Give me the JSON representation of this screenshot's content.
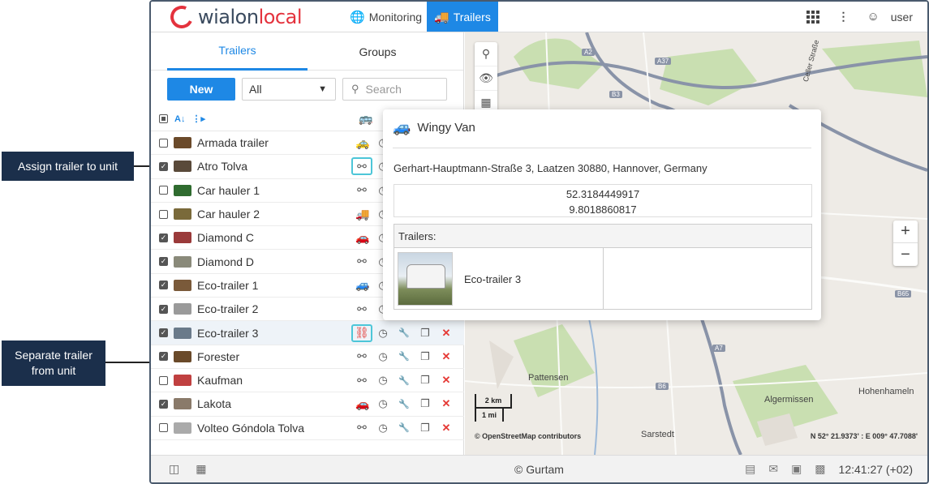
{
  "topbar": {
    "logo_text_a": "wialon",
    "logo_text_b": "local",
    "nav": [
      {
        "label": "Monitoring",
        "icon": "globe-icon"
      },
      {
        "label": "Trailers",
        "icon": "trailer-icon"
      }
    ],
    "user": "user"
  },
  "left_panel": {
    "tabs": [
      "Trailers",
      "Groups"
    ],
    "new_button": "New",
    "filter_value": "All",
    "search_placeholder": "Search",
    "rows": [
      {
        "name": "Armada trailer",
        "checked": false,
        "thumb": "#6b4a2a",
        "veh": "🚕",
        "full": false
      },
      {
        "name": "Atro Tolva",
        "checked": true,
        "thumb": "#5a4a3a",
        "veh": "",
        "full": false
      },
      {
        "name": "Car hauler 1",
        "checked": false,
        "thumb": "#2f6b2f",
        "veh": "",
        "full": false
      },
      {
        "name": "Car hauler 2",
        "checked": false,
        "thumb": "#7a6a3a",
        "veh": "🚚",
        "full": false
      },
      {
        "name": "Diamond C",
        "checked": true,
        "thumb": "#9a3a3a",
        "veh": "🚗",
        "full": false
      },
      {
        "name": "Diamond D",
        "checked": true,
        "thumb": "#8a8a7a",
        "veh": "",
        "full": false
      },
      {
        "name": "Eco-trailer 1",
        "checked": true,
        "thumb": "#7a5a3a",
        "veh": "🚙",
        "full": false
      },
      {
        "name": "Eco-trailer 2",
        "checked": true,
        "thumb": "#9a9a9a",
        "veh": "",
        "full": false
      },
      {
        "name": "Eco-trailer 3",
        "checked": true,
        "thumb": "#6a7a8a",
        "veh": "",
        "full": true
      },
      {
        "name": "Forester",
        "checked": true,
        "thumb": "#6a4a2a",
        "veh": "",
        "full": true
      },
      {
        "name": "Kaufman",
        "checked": false,
        "thumb": "#c04040",
        "veh": "",
        "full": true
      },
      {
        "name": "Lakota",
        "checked": true,
        "thumb": "#8a7a6a",
        "veh": "🚗",
        "full": true
      },
      {
        "name": "Volteo Góndola Tolva",
        "checked": false,
        "thumb": "#aaaaaa",
        "veh": "",
        "full": true
      }
    ]
  },
  "popup": {
    "unit_name": "Wingy Van",
    "address": "Gerhart-Hauptmann-Straße 3, Laatzen 30880, Hannover, Germany",
    "lat": "52.3184449917",
    "lon": "9.8018860817",
    "trailers_label": "Trailers:",
    "trailer_name": "Eco-trailer 3"
  },
  "map": {
    "scale_km": "2 km",
    "scale_mi": "1 mi",
    "attribution": "© OpenStreetMap contributors",
    "coords": "N 52° 21.9373' : E 009° 47.7088'",
    "places": [
      {
        "label": "Pattensen"
      },
      {
        "label": "Sarstedt"
      },
      {
        "label": "Algermissen"
      },
      {
        "label": "Hohenhameln"
      },
      {
        "label": "Celler Straße"
      }
    ],
    "roads": [
      "A2",
      "A37",
      "B3",
      "B65",
      "A7",
      "B6"
    ]
  },
  "bottombar": {
    "copyright": "© Gurtam",
    "time": "12:41:27 (+02)"
  },
  "callouts": {
    "assign": "Assign trailer to unit",
    "separate_line1": "Separate trailer",
    "separate_line2": "from unit"
  }
}
